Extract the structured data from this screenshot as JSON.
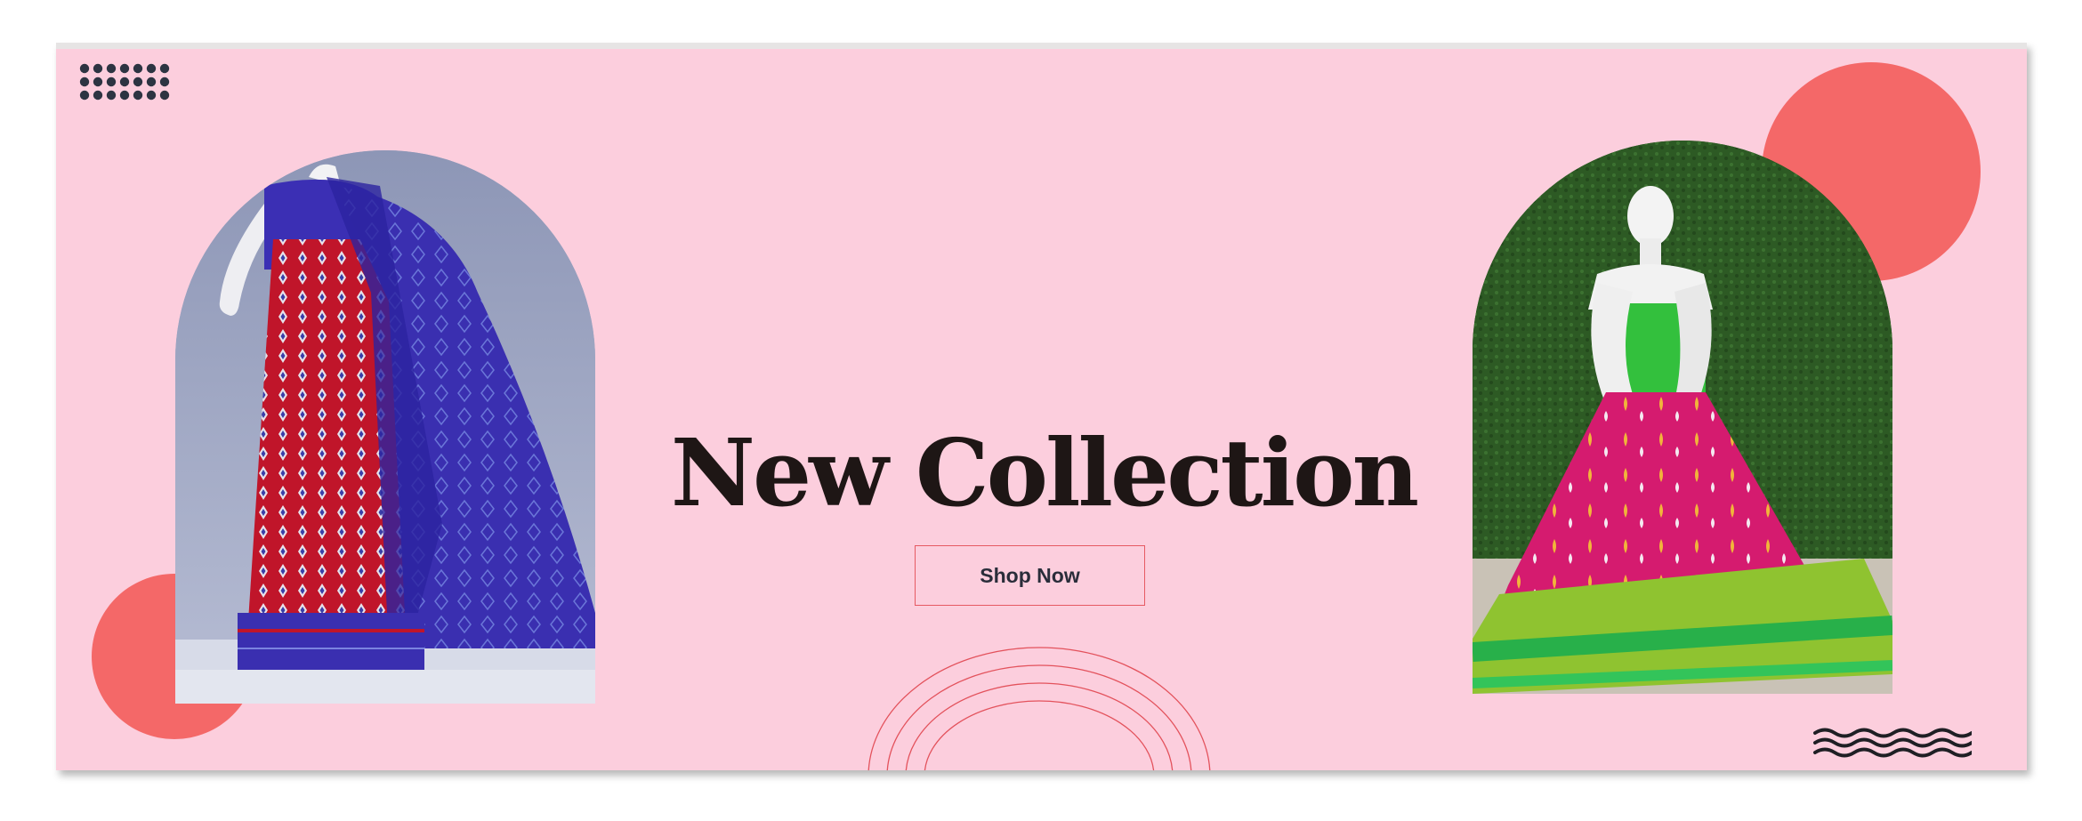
{
  "banner": {
    "title": "New Collection",
    "cta_label": "Shop Now"
  },
  "colors": {
    "background": "#fccedd",
    "accent_circle": "#f46868",
    "title_text": "#1e1615",
    "button_border": "#e65a63",
    "button_text": "#2a2d3a",
    "dots": "#2d3442"
  },
  "images": {
    "left": "saree-on-mannequin-photo",
    "right": "lehenga-on-mannequin-photo"
  },
  "decor": [
    "dot-grid-icon",
    "wave-lines-icon",
    "rainbow-arcs"
  ]
}
